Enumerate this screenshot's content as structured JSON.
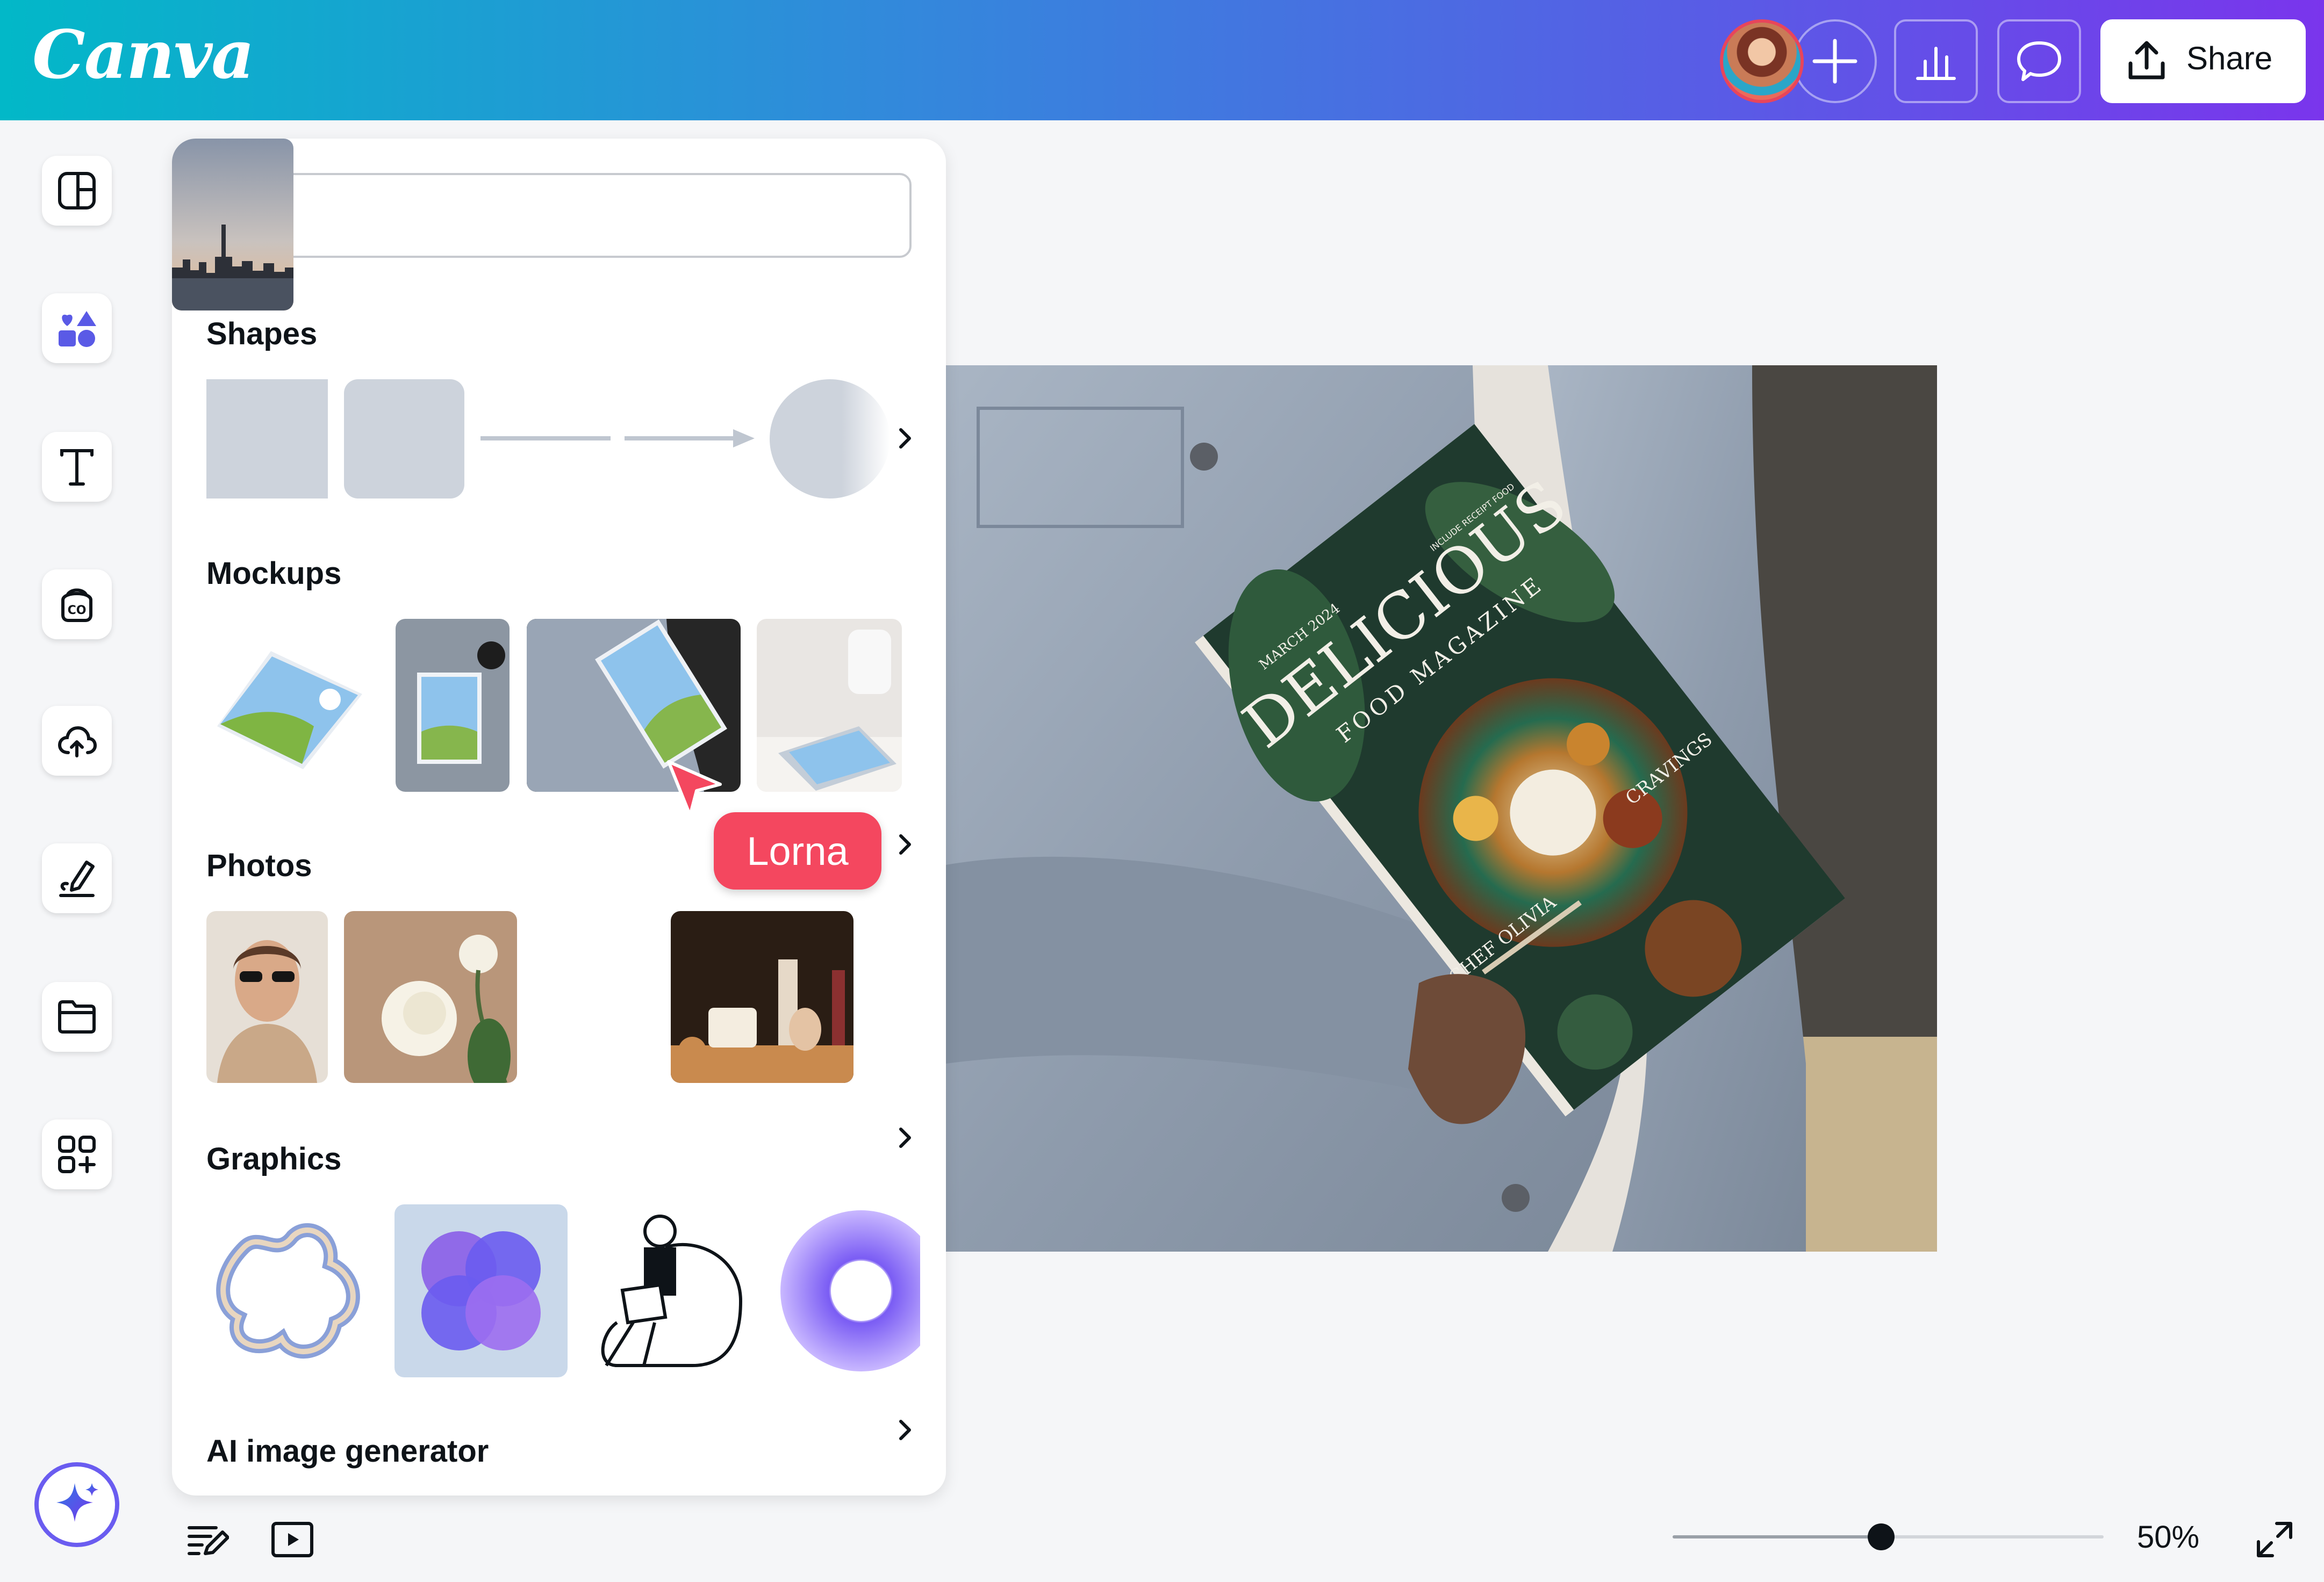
{
  "app": {
    "logo": "Canva",
    "brand_colors": {
      "gradient_start": "#02b8c8",
      "gradient_end": "#7a35ec",
      "accent": "#5a5ae6"
    }
  },
  "header": {
    "share_label": "Share",
    "icons": [
      "avatar",
      "plus-icon",
      "bar-chart-icon",
      "comment-icon",
      "upload-icon"
    ]
  },
  "sidebar": {
    "items": [
      {
        "name": "design",
        "icon": "layout-icon"
      },
      {
        "name": "elements",
        "icon": "shapes-icon",
        "active": true
      },
      {
        "name": "text",
        "icon": "text-icon"
      },
      {
        "name": "brand",
        "icon": "brand-kit-icon"
      },
      {
        "name": "uploads",
        "icon": "cloud-upload-icon"
      },
      {
        "name": "draw",
        "icon": "draw-icon"
      },
      {
        "name": "projects",
        "icon": "folder-icon"
      },
      {
        "name": "apps",
        "icon": "apps-icon"
      }
    ],
    "magic_icon": "sparkle-icon"
  },
  "panel": {
    "search": {
      "value": "",
      "placeholder": ""
    },
    "sections": {
      "shapes": "Shapes",
      "mockups": "Mockups",
      "photos": "Photos",
      "graphics": "Graphics",
      "ai": "AI image generator"
    }
  },
  "collaborator": {
    "name": "Lorna",
    "color": "#f4475f"
  },
  "canvas": {
    "magazine": {
      "title": "DELICIOUS",
      "subtitle": "FOOD MAGAZINE",
      "issue": "MARCH 2024",
      "tag": "INCLUDE RECEIPT FOOD",
      "chef": "CHEF OLIVIA",
      "cravings": "CRAVINGS"
    }
  },
  "footer": {
    "zoom": "50%",
    "zoom_level_fraction": 0.5,
    "icons": [
      "notes-icon",
      "present-icon",
      "fullscreen-icon"
    ]
  }
}
